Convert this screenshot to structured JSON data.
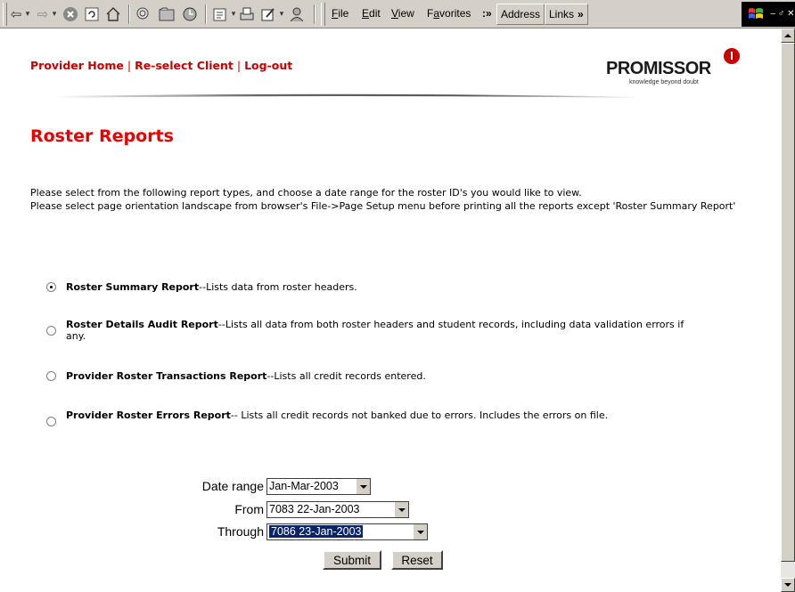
{
  "browser": {
    "menus": [
      "File",
      "Edit",
      "View",
      "Favorites"
    ],
    "more": "»",
    "address_label": "Address",
    "links_label": "Links",
    "links_more": "»",
    "window_controls": "– ♂ ✕"
  },
  "header": {
    "nav": [
      "Provider Home",
      "Re-select Client",
      "Log-out"
    ],
    "nav_separator": "|",
    "logo_text": "PROMISSOR",
    "logo_tagline": "knowledge beyond doubt"
  },
  "page_title": "Roster Reports",
  "intro": {
    "line1": "Please select from the following report types, and choose a date range for the roster ID's you would like to view.",
    "line2": "Please select page orientation landscape from browser's File->Page Setup menu before printing all the reports except 'Roster Summary Report'"
  },
  "reports": [
    {
      "name": "Roster Summary Report",
      "desc": "--Lists data from roster headers.",
      "selected": true
    },
    {
      "name": "Roster Details Audit Report",
      "desc": "--Lists all data from both roster headers and student records, including data validation errors if any.",
      "selected": false
    },
    {
      "name": "Provider Roster Transactions Report",
      "desc": "--Lists all credit records entered.",
      "selected": false
    },
    {
      "name": "Provider Roster Errors Report",
      "desc": "-- Lists all credit records not banked due to errors. Includes the errors on file.",
      "selected": false
    }
  ],
  "form": {
    "date_range_label": "Date range",
    "date_range_value": "Jan-Mar-2003",
    "from_label": "From",
    "from_value": "7083 22-Jan-2003",
    "through_label": "Through",
    "through_value": "7086 23-Jan-2003",
    "submit_label": "Submit",
    "reset_label": "Reset"
  },
  "colors": {
    "accent_red": "#cc0000",
    "title_red": "#ee0000",
    "selection_blue": "#0a246a"
  }
}
